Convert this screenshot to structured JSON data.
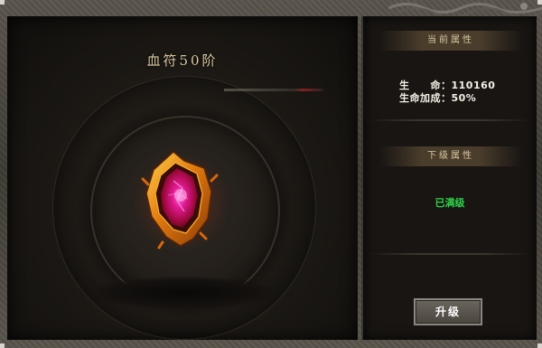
{
  "left": {
    "title": "血符50阶",
    "item_icon": "blood-talisman-gem-icon"
  },
  "right": {
    "current_header": "当前属性",
    "stats": [
      {
        "label": "生　　命：",
        "value": "110160"
      },
      {
        "label": "生命加成：",
        "value": "50%"
      }
    ],
    "next_header": "下级属性",
    "max_level_text": "已满级",
    "upgrade_label": "升级"
  },
  "colors": {
    "max_level": "#2fd24a",
    "title": "#d8c8a0",
    "gem": "#e01870"
  }
}
